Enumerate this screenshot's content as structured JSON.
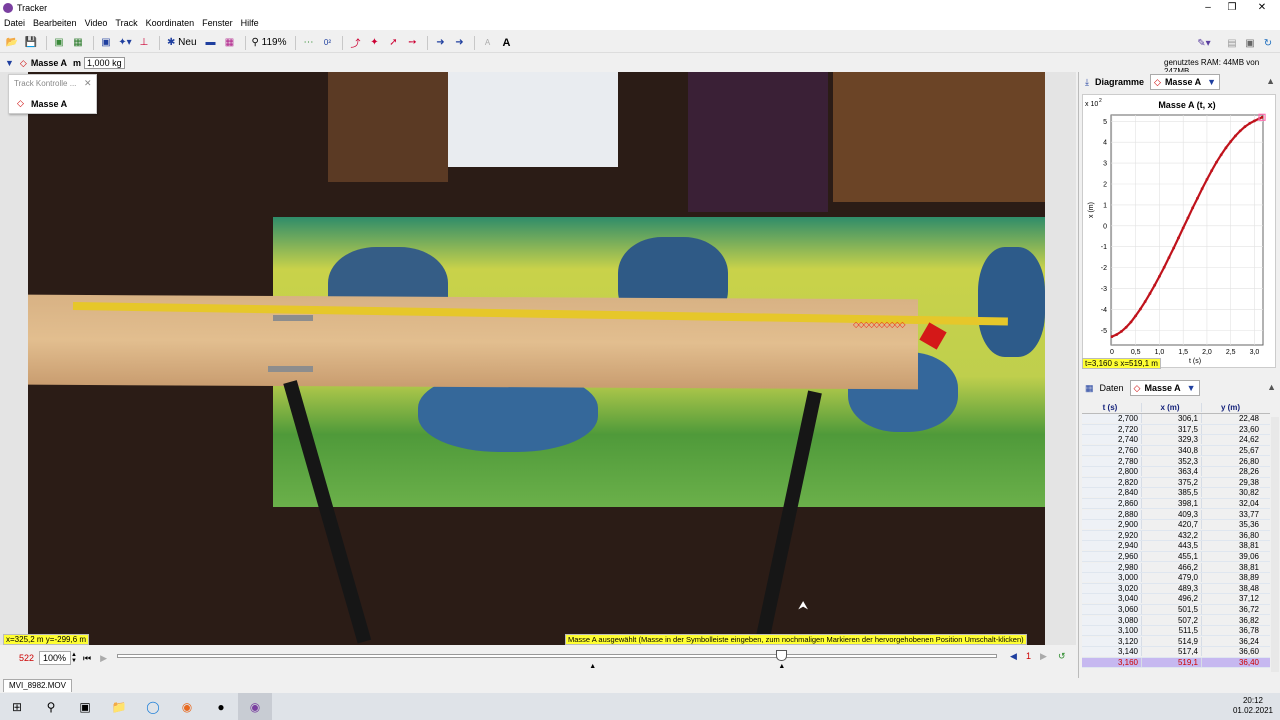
{
  "window": {
    "title": "Tracker"
  },
  "menu": [
    "Datei",
    "Bearbeiten",
    "Video",
    "Track",
    "Koordinaten",
    "Fenster",
    "Hilfe"
  ],
  "toolbar": {
    "new_label": "Neu",
    "zoom_label": "119%",
    "text_a_small": "A",
    "text_a_big": "A"
  },
  "track": {
    "name": "Masse A",
    "mass_unit_label": "m",
    "mass_value": "1,000 kg",
    "memory": "genutztes RAM: 44MB von 247MB"
  },
  "track_control": {
    "title": "Track Kontrolle ...",
    "item": "Masse A"
  },
  "video": {
    "coord_readout": "x=325,2 m  y=-299,6 m",
    "status_message": "Masse A ausgewählt (Masse in der Symbolleiste eingeben, zum nochmaligen Markieren der hervorgehobenen Position Umschalt-klicken)",
    "frame_number": "522",
    "zoom_value": "100%",
    "step_value": "1",
    "playhead_fraction": 0.755,
    "start_marker_fraction": 0.54
  },
  "video_tab": {
    "label": "MVI_8982.MOV"
  },
  "plot_panel": {
    "header_label": "Diagramme",
    "track_selector": "Masse A",
    "readout": "t=3,160 s  x=519,1 m"
  },
  "chart_data": {
    "type": "line",
    "title": "Masse A (t, x)",
    "xlabel": "t (s)",
    "ylabel": "x (m)",
    "y_multiplier_label": "x 10",
    "y_multiplier_exp": "2",
    "xlim": [
      -0.02,
      3.18
    ],
    "ylim": [
      -5.7,
      5.3
    ],
    "xticks": [
      "0",
      "0,5",
      "1,0",
      "1,5",
      "2,0",
      "2,5",
      "3,0"
    ],
    "yticks": [
      "5",
      "4",
      "3",
      "2",
      "1",
      "0",
      "-1",
      "-2",
      "-3",
      "-4",
      "-5"
    ],
    "grid": true,
    "color": "#c0131c",
    "series": [
      {
        "x": [
          0.0,
          0.1,
          0.2,
          0.3,
          0.4,
          0.5,
          0.6,
          0.7,
          0.8,
          0.9,
          1.0,
          1.1,
          1.2,
          1.3,
          1.4,
          1.5,
          1.6,
          1.7,
          1.8,
          1.9,
          2.0,
          2.1,
          2.2,
          2.3,
          2.4,
          2.5,
          2.6,
          2.7,
          2.8,
          2.9,
          3.0,
          3.1,
          3.16
        ],
        "y": [
          -5.3,
          -5.2,
          -5.05,
          -4.85,
          -4.6,
          -4.3,
          -3.98,
          -3.62,
          -3.24,
          -2.84,
          -2.42,
          -1.98,
          -1.52,
          -1.06,
          -0.58,
          -0.1,
          0.38,
          0.86,
          1.32,
          1.78,
          2.22,
          2.64,
          3.04,
          3.4,
          3.73,
          4.03,
          4.3,
          4.54,
          4.74,
          4.9,
          5.02,
          5.13,
          5.19
        ]
      }
    ]
  },
  "data_panel": {
    "header_label": "Daten",
    "track_selector": "Masse A",
    "columns": [
      "t (s)",
      "x (m)",
      "y (m)"
    ],
    "rows": [
      [
        "2,700",
        "306,1",
        "22,48"
      ],
      [
        "2,720",
        "317,5",
        "23,60"
      ],
      [
        "2,740",
        "329,3",
        "24,62"
      ],
      [
        "2,760",
        "340,8",
        "25,67"
      ],
      [
        "2,780",
        "352,3",
        "26,80"
      ],
      [
        "2,800",
        "363,4",
        "28,26"
      ],
      [
        "2,820",
        "375,2",
        "29,38"
      ],
      [
        "2,840",
        "385,5",
        "30,82"
      ],
      [
        "2,860",
        "398,1",
        "32,04"
      ],
      [
        "2,880",
        "409,3",
        "33,77"
      ],
      [
        "2,900",
        "420,7",
        "35,36"
      ],
      [
        "2,920",
        "432,2",
        "36,80"
      ],
      [
        "2,940",
        "443,5",
        "38,81"
      ],
      [
        "2,960",
        "455,1",
        "39,06"
      ],
      [
        "2,980",
        "466,2",
        "38,81"
      ],
      [
        "3,000",
        "479,0",
        "38,89"
      ],
      [
        "3,020",
        "489,3",
        "38,48"
      ],
      [
        "3,040",
        "496,2",
        "37,12"
      ],
      [
        "3,060",
        "501,5",
        "36,72"
      ],
      [
        "3,080",
        "507,2",
        "36,82"
      ],
      [
        "3,100",
        "511,5",
        "36,78"
      ],
      [
        "3,120",
        "514,9",
        "36,24"
      ],
      [
        "3,140",
        "517,4",
        "36,60"
      ],
      [
        "3,160",
        "519,1",
        "36,40"
      ]
    ]
  },
  "taskbar": {
    "time": "20:12",
    "date": "01.02.2021"
  }
}
